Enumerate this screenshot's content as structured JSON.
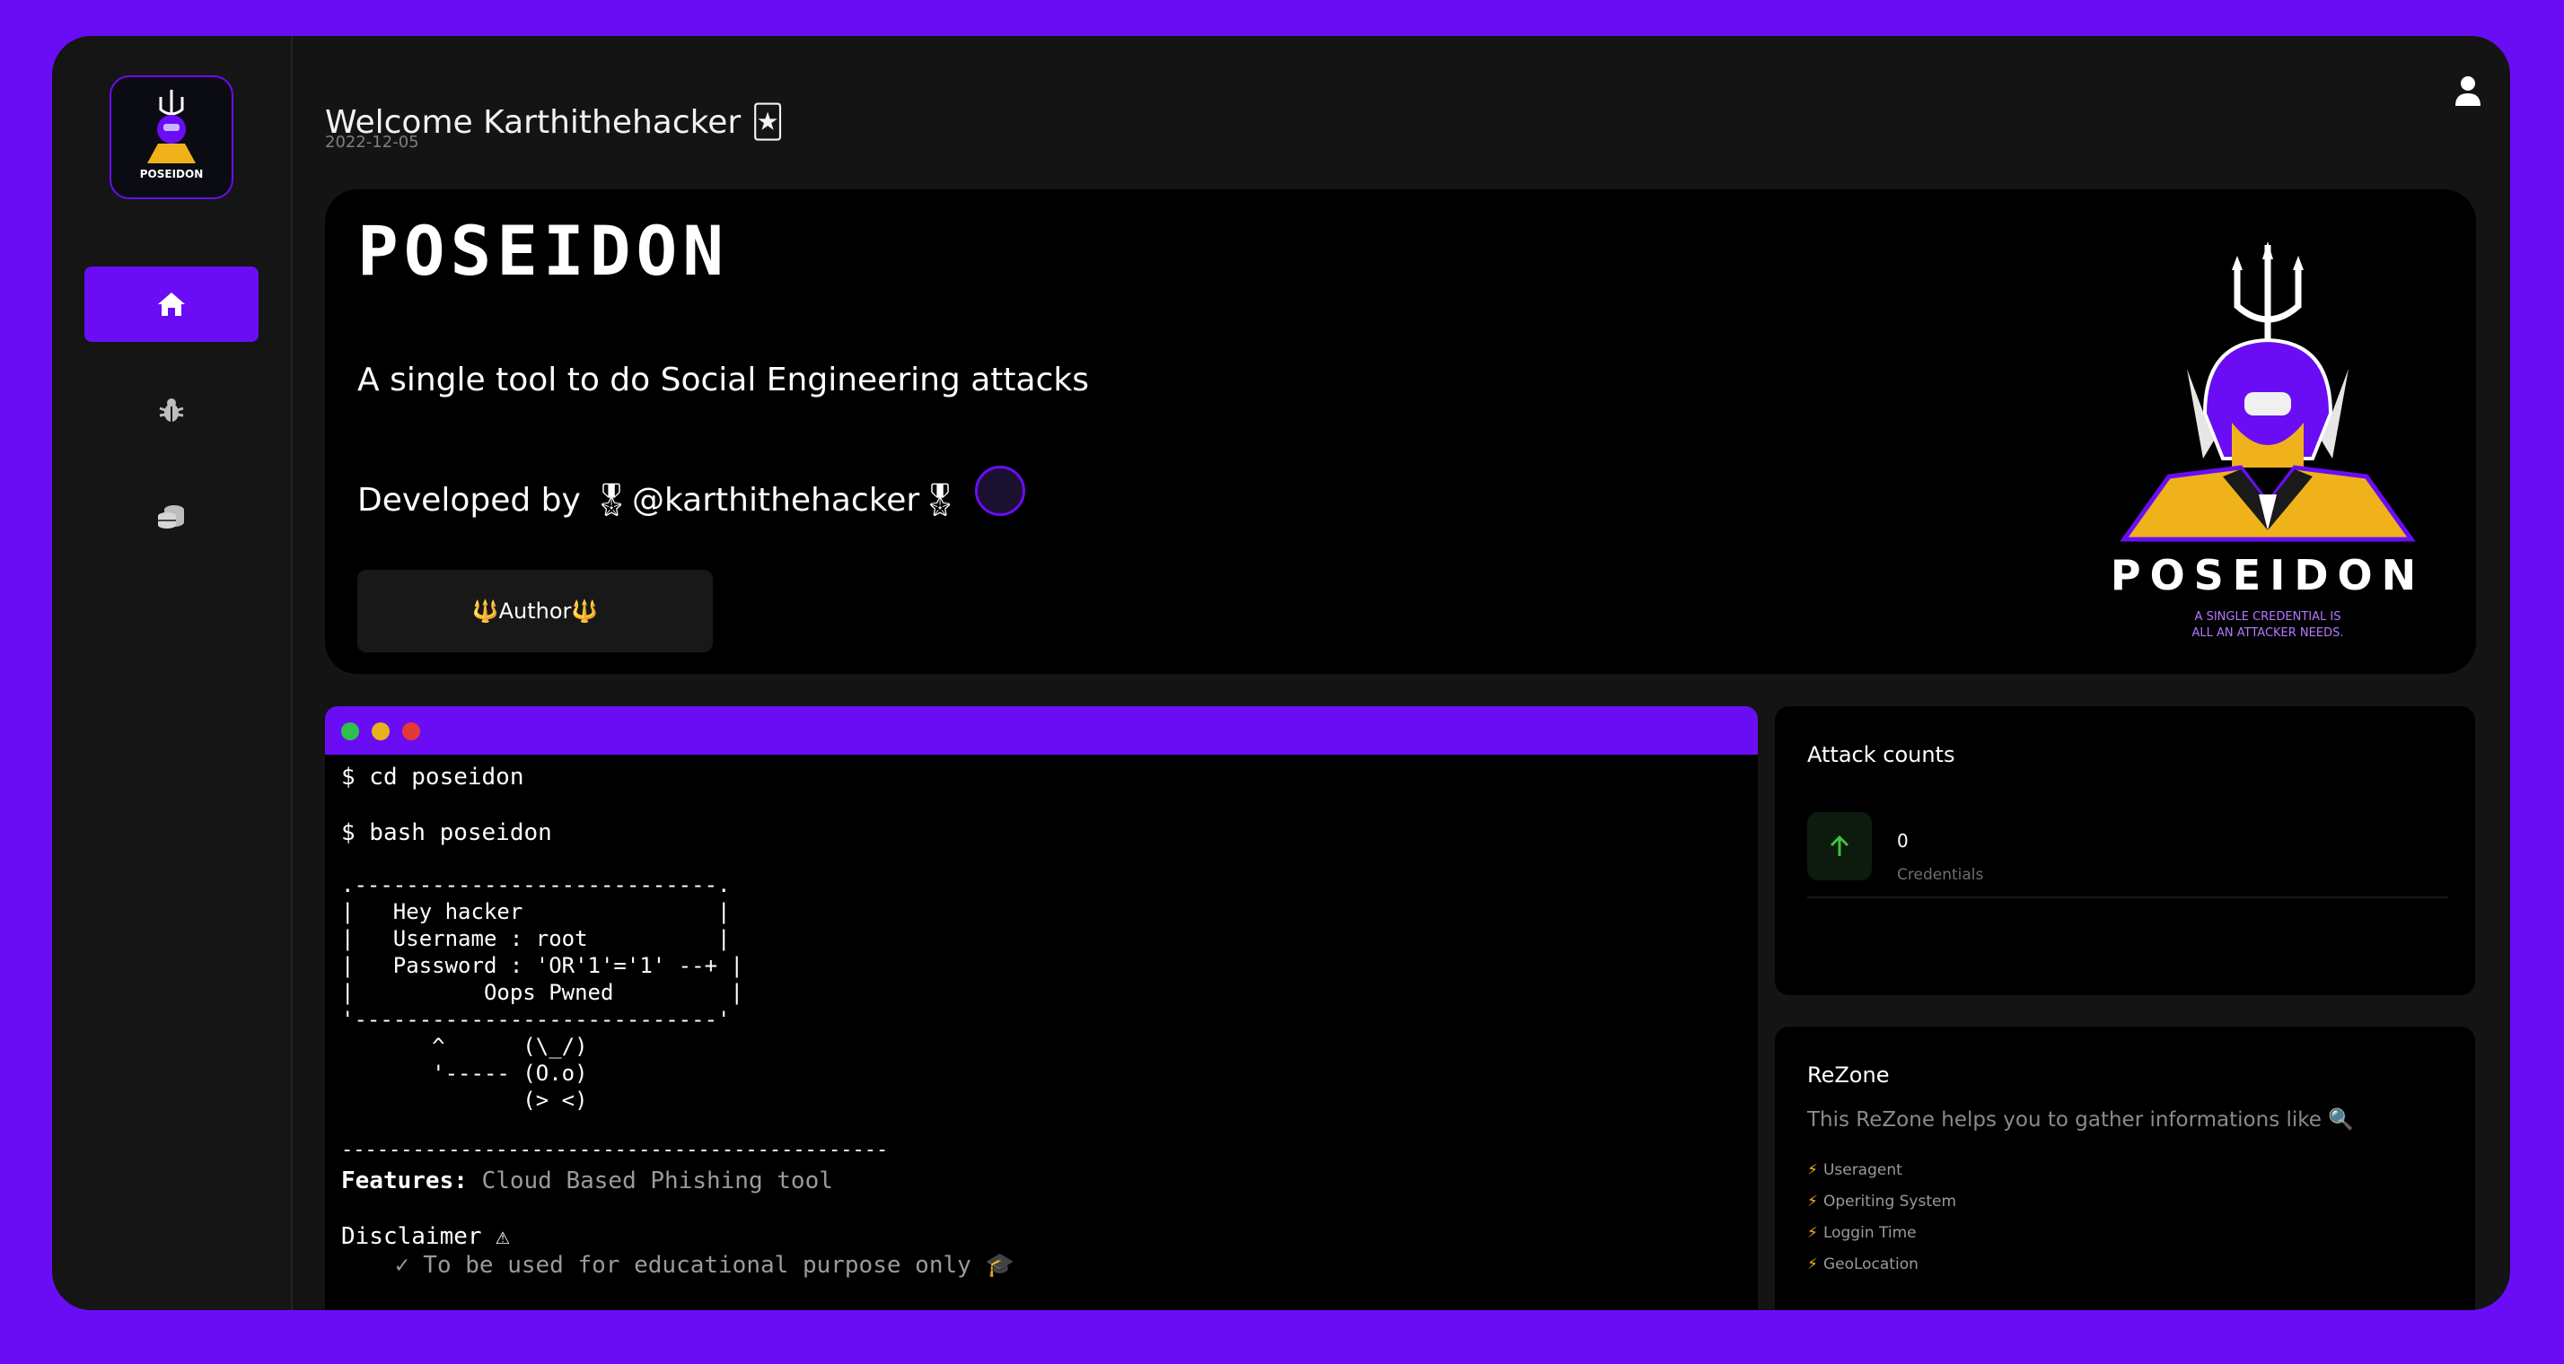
{
  "header": {
    "welcome": "Welcome Karthithehacker 🃏",
    "date": "2022-12-05"
  },
  "sidebar": {
    "logo_text": "POSEIDON",
    "items": [
      {
        "icon": "home-icon",
        "active": true
      },
      {
        "icon": "bug-icon",
        "active": false
      },
      {
        "icon": "database-icon",
        "active": false
      }
    ]
  },
  "hero": {
    "title": "POSEIDON",
    "subtitle": "A single tool to do Social Engineering attacks",
    "developed_by": "Developed by 🎖@karthithehacker🎖",
    "author_button": "🔱Author🔱",
    "logo_text": "POSEIDON",
    "logo_tagline_1": "A SINGLE CREDENTIAL IS",
    "logo_tagline_2": "ALL AN ATTACKER NEEDS."
  },
  "terminal": {
    "cmd1": "$ cd poseidon",
    "cmd2": "$ bash poseidon",
    "ascii_art": ".----------------------------.\n|   Hey hacker               |\n|   Username : root          |\n|   Password : 'OR'1'='1' --+ |\n|          Oops Pwned         |\n'----------------------------'\n       ^      (\\_/)\n       '----- (O.o)\n              (> <)",
    "divider": "----------------------------------------------",
    "features_label": "Features:",
    "features_value": " Cloud Based Phishing tool",
    "disclaimer": "Disclaimer ⚠",
    "disclaimer_item": "✓ To be used for educational purpose only 🎓"
  },
  "attack_counts": {
    "title": "Attack counts",
    "value": "0",
    "label": "Credentials"
  },
  "rezone": {
    "title": "ReZone",
    "description": "This ReZone helps you to gather informations like 🔍",
    "items": [
      "Useragent",
      "Operiting System",
      "Loggin Time",
      "GeoLocation"
    ]
  },
  "colors": {
    "accent": "#6a0df5",
    "background": "#141414",
    "panel": "#000000",
    "success": "#3ec23e",
    "gold": "#f0b21a"
  }
}
